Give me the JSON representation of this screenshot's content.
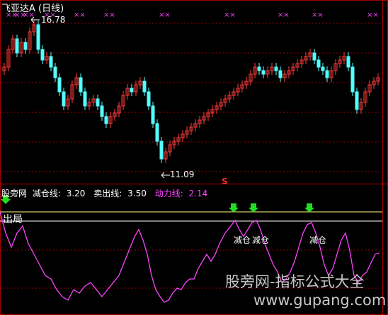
{
  "chart_header": {
    "title": "飞亚达A (日线)"
  },
  "main_panel": {
    "high_annotation": "16.78",
    "low_annotation": "11.09",
    "sell_marker": "S",
    "colors": {
      "up": "#ff3b3b",
      "down": "#54ffff",
      "gridline": "#a00000",
      "markers": "#ff44ff"
    }
  },
  "indicator_panel": {
    "name": "股旁网",
    "fields": [
      {
        "label": "减仓线:",
        "value": "3.20",
        "color": "#ffffff"
      },
      {
        "label": "卖出线:",
        "value": "3.50",
        "color": "#ffff80"
      },
      {
        "label": "动力线:",
        "value": "2.14",
        "color": "#ff44ff"
      }
    ],
    "exit_label": "出局",
    "signal_labels": [
      "减仓",
      "减仓",
      "减仓"
    ],
    "colors": {
      "line": "#ff44ff",
      "sell_line": "#ffff80",
      "reduce_line": "#ffffff",
      "arrow": "#22dd22"
    }
  },
  "watermark": {
    "line1": "股旁网-指标公式大全",
    "line2": "www.gupang.com"
  }
}
